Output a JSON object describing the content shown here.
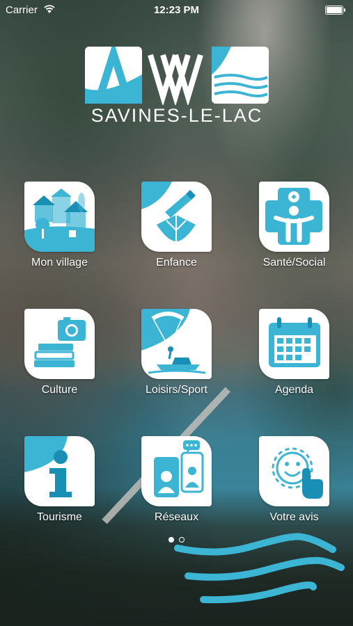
{
  "status_bar": {
    "carrier": "Carrier",
    "time": "12:23 PM"
  },
  "logo": {
    "town": "SAVINES-LE-LAC"
  },
  "colors": {
    "accent": "#3cb4d4",
    "accent_dark": "#1a8fb5",
    "card": "#ffffff"
  },
  "tiles": [
    {
      "label": "Mon village",
      "icon": "village-houses-icon"
    },
    {
      "label": "Enfance",
      "icon": "paper-boat-pencil-icon"
    },
    {
      "label": "Santé/Social",
      "icon": "health-cross-person-icon"
    },
    {
      "label": "Culture",
      "icon": "camera-books-icon"
    },
    {
      "label": "Loisirs/Sport",
      "icon": "kitesurf-boat-icon"
    },
    {
      "label": "Agenda",
      "icon": "calendar-icon"
    },
    {
      "label": "Tourisme",
      "icon": "info-icon"
    },
    {
      "label": "Réseaux",
      "icon": "phones-chat-icon"
    },
    {
      "label": "Votre avis",
      "icon": "smiley-touch-icon"
    }
  ],
  "pager": {
    "pages": 2,
    "current": 1
  }
}
